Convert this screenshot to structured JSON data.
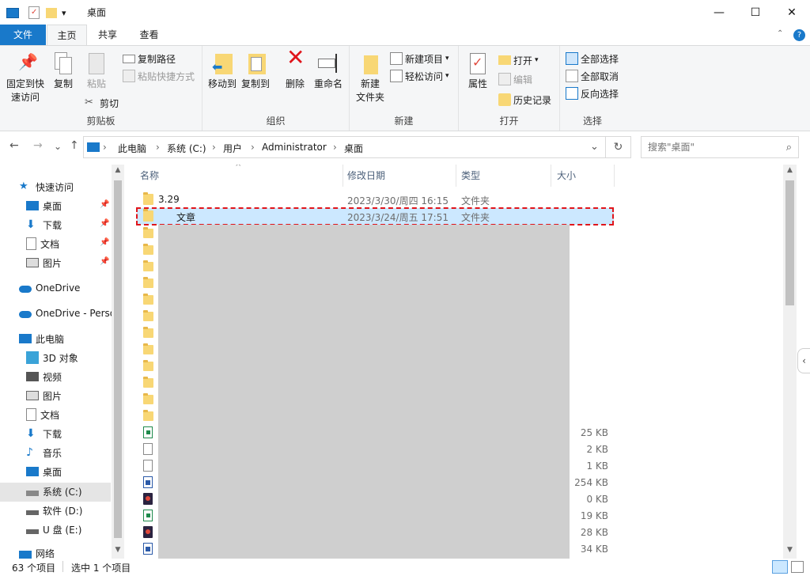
{
  "window": {
    "title": "桌面",
    "minimize": "—",
    "maximize": "☐",
    "close": "✕",
    "dropdown": "▾"
  },
  "tabs": {
    "file": "文件",
    "home": "主页",
    "share": "共享",
    "view": "查看"
  },
  "ribbon": {
    "clipboard": {
      "label": "剪贴板",
      "pin_quick": "固定到快\n速访问",
      "pin_quick_1": "固定到快",
      "pin_quick_2": "速访问",
      "copy": "复制",
      "paste": "粘贴",
      "copy_path": "复制路径",
      "paste_shortcut": "粘贴快捷方式",
      "cut": "剪切"
    },
    "organize": {
      "label": "组织",
      "move_to": "移动到",
      "copy_to": "复制到",
      "delete": "删除",
      "rename": "重命名"
    },
    "new": {
      "label": "新建",
      "new_folder_1": "新建",
      "new_folder_2": "文件夹",
      "new_item": "新建项目",
      "easy_access": "轻松访问"
    },
    "open": {
      "label": "打开",
      "properties": "属性",
      "open": "打开",
      "edit": "编辑",
      "history": "历史记录"
    },
    "select": {
      "label": "选择",
      "select_all": "全部选择",
      "select_none": "全部取消",
      "invert": "反向选择"
    }
  },
  "address": {
    "back": "←",
    "forward": "→",
    "recent": "⌄",
    "up": "↑",
    "crumbs": [
      "此电脑",
      "系统 (C:)",
      "用户",
      "Administrator",
      "桌面"
    ],
    "sep": "›",
    "dropdown": "⌄",
    "refresh": "↻",
    "search_placeholder": "搜索\"桌面\"",
    "search_icon": "⌕"
  },
  "nav": {
    "quick_access": "快速访问",
    "items_quick": [
      "桌面",
      "下载",
      "文档",
      "图片"
    ],
    "onedrive": "OneDrive",
    "onedrive_personal": "OneDrive - Perso",
    "this_pc": "此电脑",
    "items_pc": [
      "3D 对象",
      "视频",
      "图片",
      "文档",
      "下载",
      "音乐",
      "桌面",
      "系统 (C:)",
      "软件 (D:)",
      "U 盘 (E:)"
    ],
    "network": "网络",
    "pin": "📌"
  },
  "columns": {
    "name": "名称",
    "modified": "修改日期",
    "type": "类型",
    "size": "大小",
    "sort_indicator": "^"
  },
  "files": [
    {
      "name": "3.29",
      "modified": "2023/3/30/周四 16:15",
      "type": "文件夹"
    },
    {
      "name": "文章",
      "modified": "2023/3/24/周五 17:51",
      "type": "文件夹"
    }
  ],
  "sizes": [
    "25 KB",
    "2 KB",
    "1 KB",
    "254 KB",
    "0 KB",
    "19 KB",
    "28 KB",
    "34 KB"
  ],
  "status": {
    "count": "63 个项目",
    "selected": "选中 1 个项目"
  },
  "colors": {
    "accent": "#1979ca",
    "selection": "#cce8ff",
    "highlight_box": "#e0151b",
    "folder": "#f8d775"
  }
}
